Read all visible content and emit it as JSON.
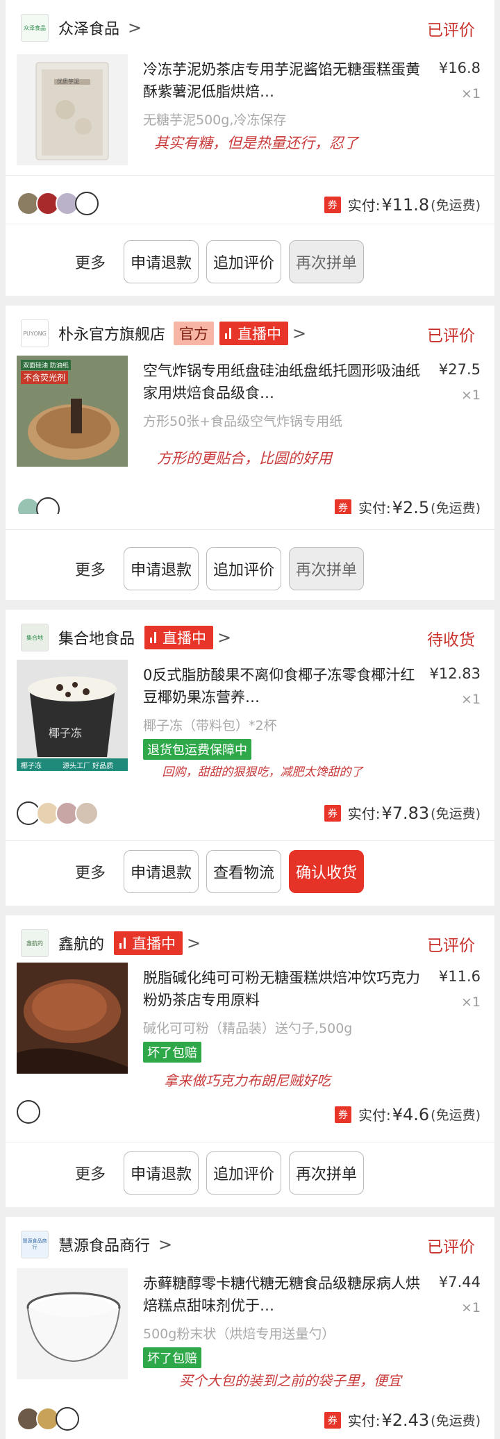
{
  "orders": [
    {
      "store": {
        "logo_text": "众泽食品",
        "name": "众泽食品",
        "chevron": ">"
      },
      "status": "已评价",
      "product": {
        "title": "冷冻芋泥奶茶店专用芋泥酱馅无糖蛋糕蛋黄酥紫薯泥低脂烘焙…",
        "price": "¥16.8",
        "qty": "×1",
        "spec": "无糖芋泥500g,冷冻保存",
        "image_label": "优质芋泥"
      },
      "note": "其实有糖，但是热量还行，忍了",
      "paid": {
        "coupon": "券",
        "label": "实付:",
        "amount": "¥11.8",
        "fee": "(免运费)"
      },
      "actions": {
        "more": "更多",
        "b1": "申请退款",
        "b2": "追加评价",
        "b3": "再次拼单"
      }
    },
    {
      "store": {
        "logo_text": "PUYONG",
        "name": "朴永官方旗舰店",
        "official": "官方",
        "live": "直播中",
        "chevron": ">"
      },
      "status": "已评价",
      "product": {
        "title": "空气炸锅专用纸盘硅油纸盘纸托圆形吸油纸家用烘焙食品级食…",
        "price": "¥27.5",
        "qty": "×1",
        "spec": "方形50张+食品级空气炸锅专用纸",
        "image_label_1": "双面硅油 防油纸",
        "image_label_2": "不含荧光剂"
      },
      "note": "方形的更贴合，比圆的好用",
      "paid": {
        "coupon": "券",
        "label": "实付:",
        "amount": "¥2.5",
        "fee": "(免运费)"
      },
      "actions": {
        "more": "更多",
        "b1": "申请退款",
        "b2": "追加评价",
        "b3": "再次拼单"
      }
    },
    {
      "store": {
        "logo_text": "集合地",
        "name": "集合地食品",
        "live": "直播中",
        "chevron": ">"
      },
      "status": "待收货",
      "product": {
        "title": "0反式脂肪酸果不离仰食椰子冻零食椰汁红豆椰奶果冻营养…",
        "price": "¥12.83",
        "qty": "×1",
        "spec": "椰子冻（带料包）*2杯",
        "badge": "退货包运费保障中",
        "image_label_1": "椰子冻",
        "image_label_2": "椰子冻",
        "image_label_3": "源头工厂  好品质"
      },
      "note": "回购，甜甜的狠狠吃，减肥太馋甜的了",
      "paid": {
        "coupon": "券",
        "label": "实付:",
        "amount": "¥7.83",
        "fee": "(免运费)"
      },
      "actions": {
        "more": "更多",
        "b1": "申请退款",
        "b2": "查看物流",
        "b3": "确认收货"
      }
    },
    {
      "store": {
        "logo_text": "鑫航的",
        "name": "鑫航的",
        "live": "直播中",
        "chevron": ">"
      },
      "status": "已评价",
      "product": {
        "title": "脱脂碱化纯可可粉无糖蛋糕烘焙冲饮巧克力粉奶茶店专用原料",
        "price": "¥11.6",
        "qty": "×1",
        "spec": "碱化可可粉（精品装）送勺子,500g",
        "badge": "坏了包赔"
      },
      "note": "拿来做巧克力布朗尼贼好吃",
      "paid": {
        "coupon": "券",
        "label": "实付:",
        "amount": "¥4.6",
        "fee": "(免运费)"
      },
      "actions": {
        "more": "更多",
        "b1": "申请退款",
        "b2": "追加评价",
        "b3": "再次拼单"
      }
    },
    {
      "store": {
        "logo_text": "慧源食品商行",
        "name": "慧源食品商行",
        "chevron": ">"
      },
      "status": "已评价",
      "product": {
        "title": "赤藓糖醇零卡糖代糖无糖食品级糖尿病人烘焙糕点甜味剂优于…",
        "price": "¥7.44",
        "qty": "×1",
        "spec": "500g粉末状（烘焙专用送量勺）",
        "badge": "坏了包赔"
      },
      "note": "买个大包的装到之前的袋子里，便宜",
      "paid": {
        "coupon": "券",
        "label": "实付:",
        "amount": "¥2.43",
        "fee": "(免运费)"
      }
    }
  ],
  "colors": {
    "accent_red": "#e53327",
    "status_red": "#c8302a",
    "green_badge": "#2fa84a",
    "note_red": "#c93b3b"
  }
}
